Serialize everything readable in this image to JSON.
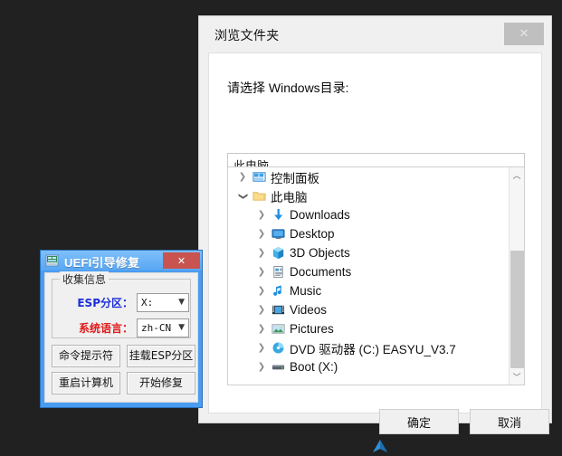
{
  "desktop": {
    "background_color": "#212121",
    "taskbar_icon": "blue-arrow-icon"
  },
  "browse_dialog": {
    "title": "浏览文件夹",
    "close_label": "✕",
    "prompt": "请选择 Windows目录:",
    "path_input": {
      "value": "此电脑",
      "placeholder": ""
    },
    "tree": [
      {
        "label": "控制面板",
        "icon": "control-panel-icon",
        "indent": 0,
        "expanded": false
      },
      {
        "label": "此电脑",
        "icon": "folder-icon",
        "indent": 0,
        "expanded": true
      },
      {
        "label": "Downloads",
        "icon": "downloads-icon",
        "indent": 1,
        "expanded": false
      },
      {
        "label": "Desktop",
        "icon": "desktop-icon",
        "indent": 1,
        "expanded": false
      },
      {
        "label": "3D Objects",
        "icon": "3d-objects-icon",
        "indent": 1,
        "expanded": false
      },
      {
        "label": "Documents",
        "icon": "documents-icon",
        "indent": 1,
        "expanded": false
      },
      {
        "label": "Music",
        "icon": "music-icon",
        "indent": 1,
        "expanded": false
      },
      {
        "label": "Videos",
        "icon": "videos-icon",
        "indent": 1,
        "expanded": false
      },
      {
        "label": "Pictures",
        "icon": "pictures-icon",
        "indent": 1,
        "expanded": false
      },
      {
        "label": "DVD 驱动器 (C:) EASYU_V3.7",
        "icon": "dvd-drive-icon",
        "indent": 1,
        "expanded": false
      },
      {
        "label": "Boot (X:)",
        "icon": "hard-drive-icon",
        "indent": 1,
        "expanded": false
      }
    ],
    "scrollbar": {
      "up_arrow": "︿",
      "down_arrow": "﹀"
    },
    "buttons": {
      "ok": "确定",
      "cancel": "取消"
    }
  },
  "uefi_dialog": {
    "title": "UEFI引导修复",
    "icon": "app-icon",
    "close_label": "✕",
    "titlebar_color": "#57a6f3",
    "close_color": "#c9534f",
    "group": {
      "legend": "收集信息",
      "fields": [
        {
          "label": "ESP分区：",
          "label_color": "#1e2fd6",
          "value": "X:"
        },
        {
          "label": "系统语言：",
          "label_color": "#e01b1b",
          "value": "zh-CN"
        }
      ]
    },
    "buttons": {
      "cmd_prompt": "命令提示符",
      "mount_esp": "挂载ESP分区",
      "reboot": "重启计算机",
      "start_repair": "开始修复"
    }
  }
}
